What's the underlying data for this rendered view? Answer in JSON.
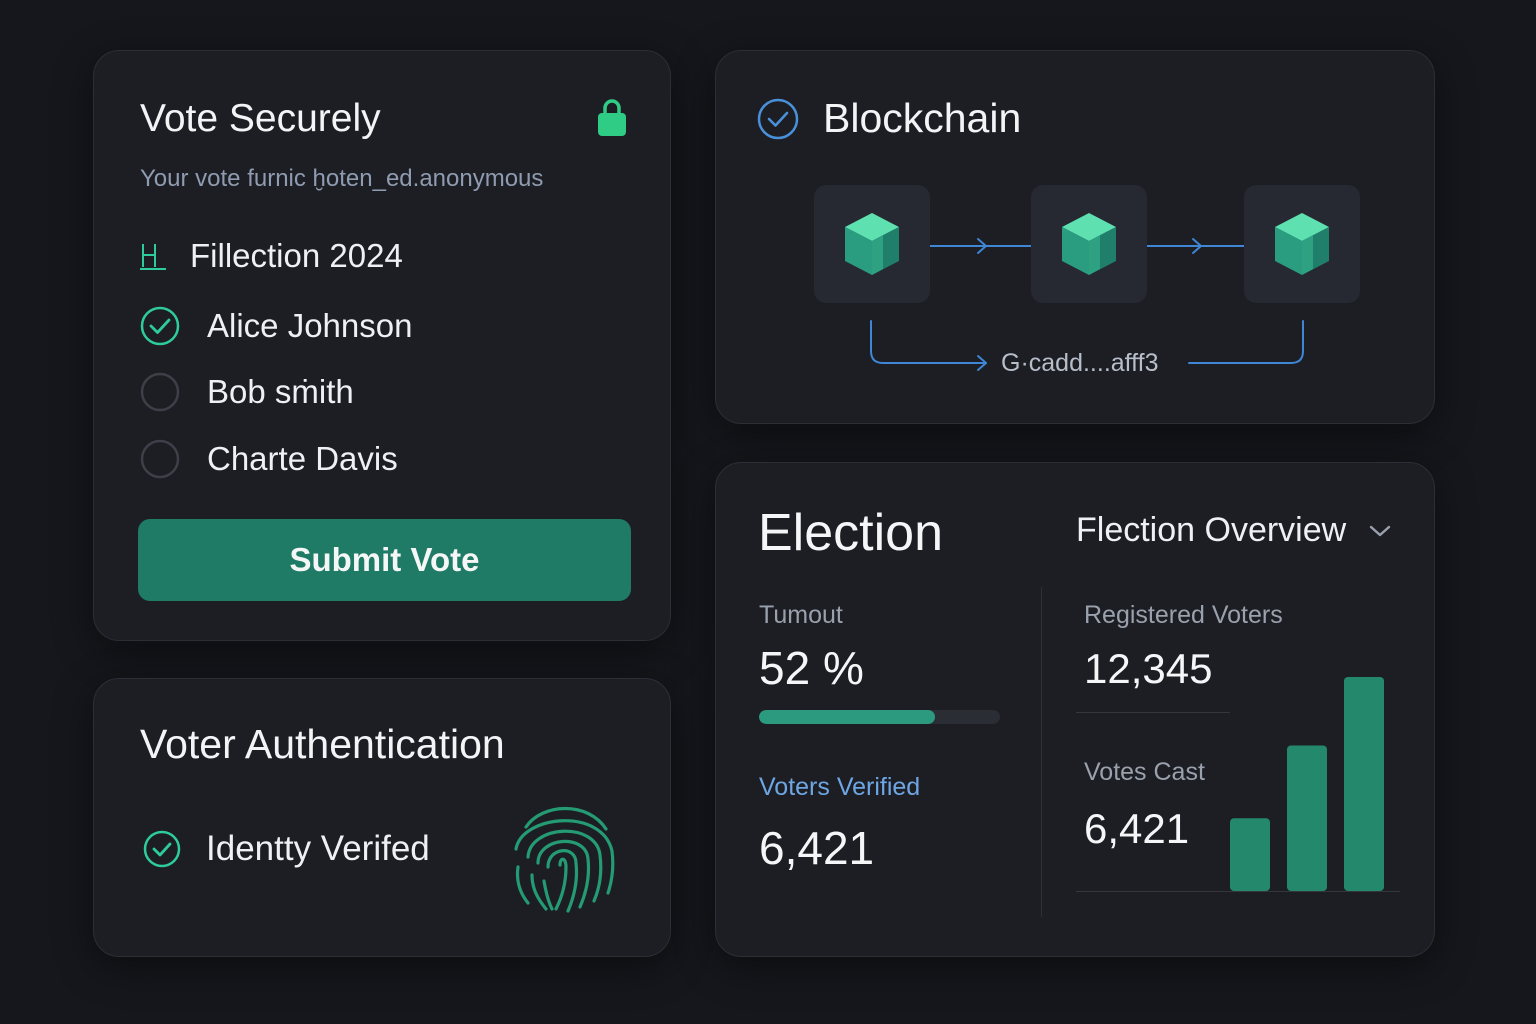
{
  "vote": {
    "title": "Vote Securely",
    "subtitle": "Your vote furnic ḫoten_ed.anonymous",
    "election_name": "Fillection 2024",
    "options": [
      {
        "label": "Alice Johnson",
        "selected": true
      },
      {
        "label": "Bob sṁith",
        "selected": false
      },
      {
        "label": "Charte Davis",
        "selected": false
      }
    ],
    "submit_label": "Submit Vote"
  },
  "auth": {
    "title": "Voter Authentication",
    "identity_label": "Identty Verifed"
  },
  "blockchain": {
    "title": "Blockchain",
    "hash": "G·cadd....afff3"
  },
  "election": {
    "title": "Election",
    "overview_select": "Flection Overview",
    "turnout_label": "Tumout",
    "turnout_value": "52 %",
    "turnout_fraction": 0.73,
    "verified_label": "Voters Verified",
    "verified_value": "6,421",
    "registered_label": "Registered Voters",
    "registered_value": "12,345",
    "votes_cast_label": "Votes Cast",
    "votes_cast_value": "6,421",
    "mini_bars": [
      0.34,
      0.68,
      1.0
    ]
  },
  "colors": {
    "background": "#15171c",
    "card": "#1c1e24",
    "accent_green": "#1f7a66",
    "bright_green": "#2ecc9a",
    "link_blue": "#4a90d9"
  },
  "icons": [
    "lock-icon",
    "ballot-icon",
    "check-circle-icon",
    "radio-empty-icon",
    "fingerprint-icon",
    "blockchain-check-icon",
    "cube-icon",
    "chevron-down-icon"
  ]
}
